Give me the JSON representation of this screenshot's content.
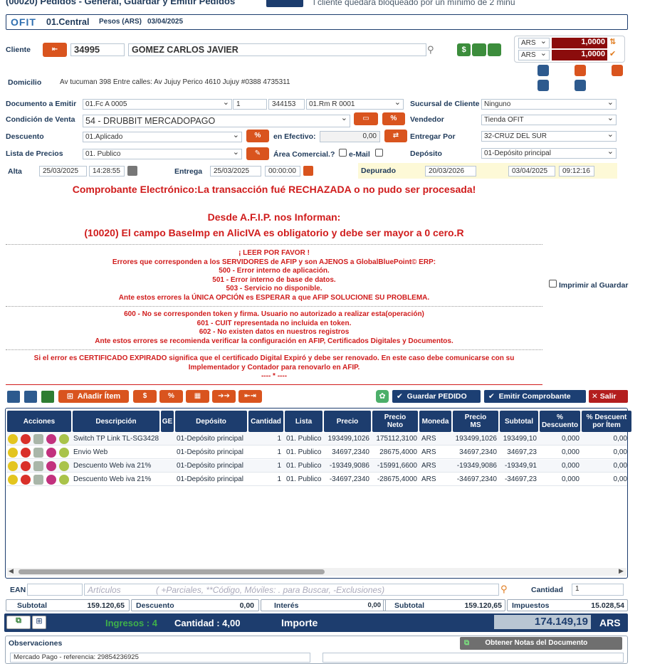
{
  "window": {
    "title": "(00020) Pedidos - General, Guardar y Emitir Pedidos",
    "notice": "l cliente quedará bloqueado por un mínimo de 2 minu"
  },
  "header": {
    "logo": "OFIT",
    "branch": "01.Central",
    "currency": "Pesos (ARS)",
    "date": "03/04/2025"
  },
  "client": {
    "label": "Cliente",
    "code": "34995",
    "name": "GOMEZ CARLOS JAVIER"
  },
  "currency_rates": [
    {
      "cur": "ARS",
      "value": "1,0000"
    },
    {
      "cur": "ARS",
      "value": "1,0000"
    }
  ],
  "address": {
    "label": "Domicilio",
    "value": "Av tucuman 398 Entre calles: Av Jujuy Perico 4610 Jujuy #0388 4735311"
  },
  "form": {
    "doc_label": "Documento a Emitir",
    "doc_value": "01.Fc A 0005",
    "doc_num1": "1",
    "doc_num2": "344153",
    "doc_rm": "01.Rm R 0001",
    "branch_client_label": "Sucursal de Cliente",
    "branch_client_value": "Ninguno",
    "sale_cond_label": "Condición de Venta",
    "sale_cond_value": "54 - DRUBBIT MERCADOPAGO",
    "seller_label": "Vendedor",
    "seller_value": "Tienda OFIT",
    "discount_label": "Descuento",
    "discount_value": "01.Aplicado",
    "cash_label": "en Efectivo:",
    "cash_value": "0,00",
    "deliver_by_label": "Entregar Por",
    "deliver_by_value": "32-CRUZ DEL SUR",
    "price_list_label": "Lista de Precios",
    "price_list_value": "01. Publico",
    "commercial_area_label": "Área Comercial.?",
    "email_label": "e-Mail",
    "deposit_label": "Depósito",
    "deposit_value": "01-Depósito principal",
    "alta_label": "Alta",
    "alta_date": "25/03/2025",
    "alta_time": "14:28:55",
    "delivery_label": "Entrega",
    "delivery_date": "25/03/2025",
    "delivery_time": "00:00:00",
    "purged_label": "Depurado",
    "purged_date": "20/03/2026",
    "purged_date2": "03/04/2025",
    "purged_time": "09:12:16"
  },
  "error": {
    "line1": "Comprobante Electrónico:La transacción fué RECHAZADA o no pudo ser procesada!",
    "line2": "Desde A.F.I.P. nos Informan:",
    "line3": "(10020) El campo BaseImp en AlicIVA es obligatorio y debe ser mayor a 0 cero.R",
    "block1": [
      "¡ LEER POR FAVOR !",
      "Errores que corresponden a los SERVIDORES de AFIP y son AJENOS a GlobalBluePoint© ERP:",
      "500 - Error interno de aplicación.",
      "501 - Error interno de base de datos.",
      "503 - Servicio no disponible.",
      "Ante estos errores la ÚNICA OPCIÓN es ESPERAR a que AFIP SOLUCIONE SU PROBLEMA."
    ],
    "block2": [
      "600 - No se corresponden token y firma. Usuario no autorizado a realizar esta(operación)",
      "601 - CUIT representada no incluida en token.",
      "602 - No existen datos en nuestros registros",
      "Ante estos errores se recomienda verificar la configuración en AFIP, Certificados Digitales y Documentos."
    ],
    "block3": [
      "Si el error es CERTIFICADO EXPIRADO significa que el certificado Digital Expiró y debe ser renovado. En este caso debe comunicarse con su",
      "Implementador y Contador para renovarlo en AFIP.",
      "---- * ----"
    ]
  },
  "print_on_save": "Imprimir al Guardar",
  "toolbar": {
    "add_item": "Añadir Ítem",
    "save_order": "Guardar PEDIDO",
    "emit": "Emitir Comprobante",
    "exit": "Salir"
  },
  "table": {
    "headers": [
      "Acciones",
      "Descripción",
      "GE",
      "Depósito",
      "Cantidad",
      "Lista",
      "Precio",
      "Precio Neto",
      "Moneda",
      "Precio MS",
      "Subtotal",
      "% Descuento",
      "% Descuent por Ítem"
    ],
    "rows": [
      [
        "Switch TP Link TL-SG3428",
        "01-Depósito principal",
        "1",
        "01. Publico",
        "193499,1026",
        "175112,3100",
        "ARS",
        "193499,1026",
        "193499,10",
        "0,000",
        "0,00"
      ],
      [
        "Envio Web",
        "01-Depósito principal",
        "1",
        "01. Publico",
        "34697,2340",
        "28675,4000",
        "ARS",
        "34697,2340",
        "34697,23",
        "0,000",
        "0,00"
      ],
      [
        "Descuento Web iva 21%",
        "01-Depósito principal",
        "1",
        "01. Publico",
        "-19349,9086",
        "-15991,6600",
        "ARS",
        "-19349,9086",
        "-19349,91",
        "0,000",
        "0,00"
      ],
      [
        "Descuento Web iva 21%",
        "01-Depósito principal",
        "1",
        "01. Publico",
        "-34697,2340",
        "-28675,4000",
        "ARS",
        "-34697,2340",
        "-34697,23",
        "0,000",
        "0,00"
      ]
    ]
  },
  "search": {
    "ean_label": "EAN",
    "placeholder_articles": "Artículos",
    "placeholder_hint": "( +Parciales, **Código, Móviles: . para Buscar, -Exclusiones)",
    "qty_label": "Cantidad",
    "qty_value": "1"
  },
  "totals": {
    "subtotal_label": "Subtotal",
    "subtotal": "159.120,65",
    "discount_label": "Descuento",
    "discount": "0,00",
    "interest_label": "Interés",
    "interest": "0,00",
    "subtotal2_label": "Subtotal",
    "subtotal2": "159.120,65",
    "taxes_label": "Impuestos",
    "taxes": "15.028,54"
  },
  "footer": {
    "incomes": "Ingresos : 4",
    "quantity": "Cantidad : 4,00",
    "amount_label": "Importe",
    "amount": "174.149,19",
    "currency": "ARS"
  },
  "notes": {
    "label": "Observaciones",
    "get_notes": "Obtener Notas del Documento",
    "value": "Mercado Pago - referencia: 29854236925"
  },
  "colors": {
    "navy": "#1d3d6e",
    "orange": "#d9541e",
    "error": "#d01c1c",
    "green": "#2e7d32"
  }
}
